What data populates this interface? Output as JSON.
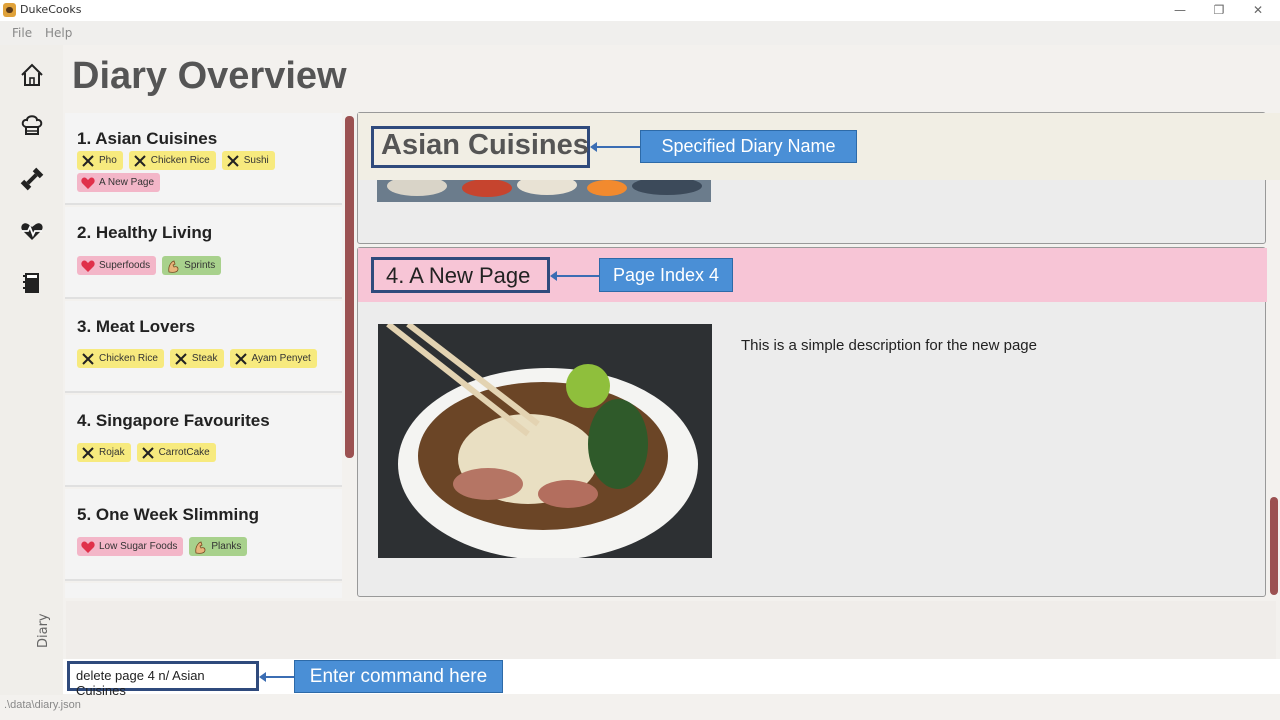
{
  "window": {
    "title": "DukeCooks",
    "minimize": "—",
    "restore": "❐",
    "close": "✕"
  },
  "menu": {
    "file": "File",
    "help": "Help"
  },
  "sidebar": {
    "vertical_tab": "Diary"
  },
  "header": {
    "title": "Diary Overview"
  },
  "diaries": [
    {
      "title": "1.  Asian Cuisines",
      "tags": [
        {
          "label": "Pho",
          "kind": "food"
        },
        {
          "label": "Chicken Rice",
          "kind": "food"
        },
        {
          "label": "Sushi",
          "kind": "food"
        },
        {
          "label": "A New Page",
          "kind": "health"
        }
      ]
    },
    {
      "title": "2.  Healthy Living",
      "tags": [
        {
          "label": "Superfoods",
          "kind": "health"
        },
        {
          "label": "Sprints",
          "kind": "exercise"
        }
      ]
    },
    {
      "title": "3.  Meat Lovers",
      "tags": [
        {
          "label": "Chicken Rice",
          "kind": "food"
        },
        {
          "label": "Steak",
          "kind": "food"
        },
        {
          "label": "Ayam Penyet",
          "kind": "food"
        }
      ]
    },
    {
      "title": "4.  Singapore Favourites",
      "tags": [
        {
          "label": "Rojak",
          "kind": "food"
        },
        {
          "label": "CarrotCake",
          "kind": "food"
        }
      ]
    },
    {
      "title": "5.  One Week Slimming",
      "tags": [
        {
          "label": "Low Sugar Foods",
          "kind": "health"
        },
        {
          "label": "Planks",
          "kind": "exercise"
        }
      ]
    }
  ],
  "detail": {
    "diary_name": "Asian Cuisines",
    "page_title": "4. A New Page",
    "page_description": "This is a simple description for the new page"
  },
  "callouts": {
    "diary_name": "Specified Diary Name",
    "page_index": "Page Index 4",
    "command": "Enter command here"
  },
  "command": {
    "value": "delete page 4 n/ Asian Cuisines"
  },
  "status": {
    "path": ".\\data\\diary.json"
  },
  "colors": {
    "food_tag": "#f7ea7e",
    "health_tag": "#f3b6c8",
    "exercise_tag": "#a8d18c",
    "scrollbar": "#9b5151",
    "callout": "#4a8fd6"
  }
}
